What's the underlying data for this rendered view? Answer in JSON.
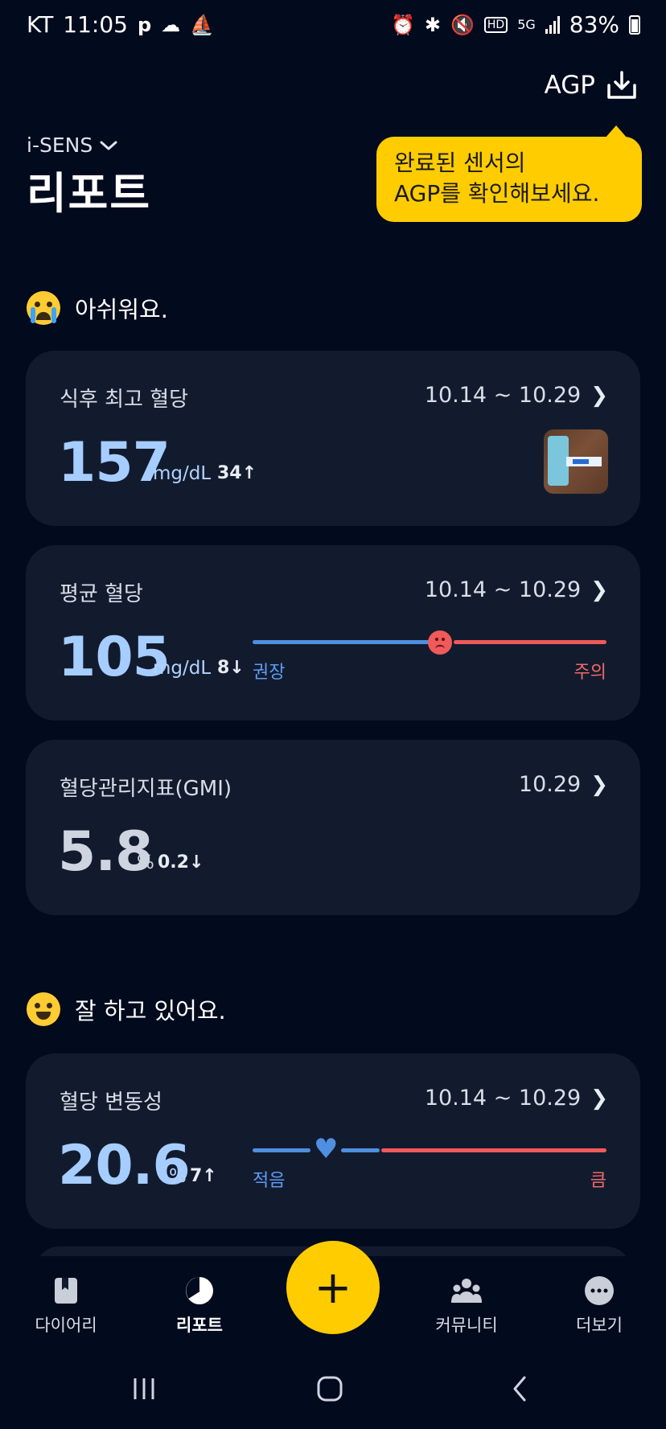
{
  "status_bar": {
    "carrier": "KT",
    "time": "11:05",
    "battery": "83%"
  },
  "header": {
    "agp_label": "AGP",
    "brand": "i-SENS",
    "title": "리포트"
  },
  "tooltip": {
    "line1": "완료된 센서의",
    "line2": "AGP를 확인해보세요."
  },
  "sections": {
    "bad": "아쉬워요.",
    "good": "잘 하고 있어요."
  },
  "cards": {
    "postmeal": {
      "title": "식후 최고 혈당",
      "period": "10.14 ~ 10.29",
      "value": "157",
      "unit": "mg/dL",
      "delta": "34↑"
    },
    "average": {
      "title": "평균 혈당",
      "period": "10.14 ~ 10.29",
      "value": "105",
      "unit": "mg/dL",
      "delta": "8↓",
      "gauge_left": "권장",
      "gauge_right": "주의",
      "gauge_level": 0.53
    },
    "gmi": {
      "title": "혈당관리지표(GMI)",
      "period": "10.29",
      "value": "5.8",
      "unit": "%",
      "delta": "0.2↓"
    },
    "variability": {
      "title": "혈당 변동성",
      "period": "10.14 ~ 10.29",
      "value": "20.6",
      "unit": "%",
      "delta": "7↑",
      "gauge_left": "적음",
      "gauge_right": "큼",
      "gauge_level": 0.21
    }
  },
  "bottom_nav": {
    "diary": "다이어리",
    "report": "리포트",
    "community": "커뮤니티",
    "more": "더보기",
    "add": "+"
  },
  "colors": {
    "background": "#020a1d",
    "card": "#121b2e",
    "accent_yellow": "#ffcc00",
    "value_blue": "#a6cdff",
    "gauge_blue": "#4f8fe0",
    "gauge_red": "#f05a5a"
  }
}
